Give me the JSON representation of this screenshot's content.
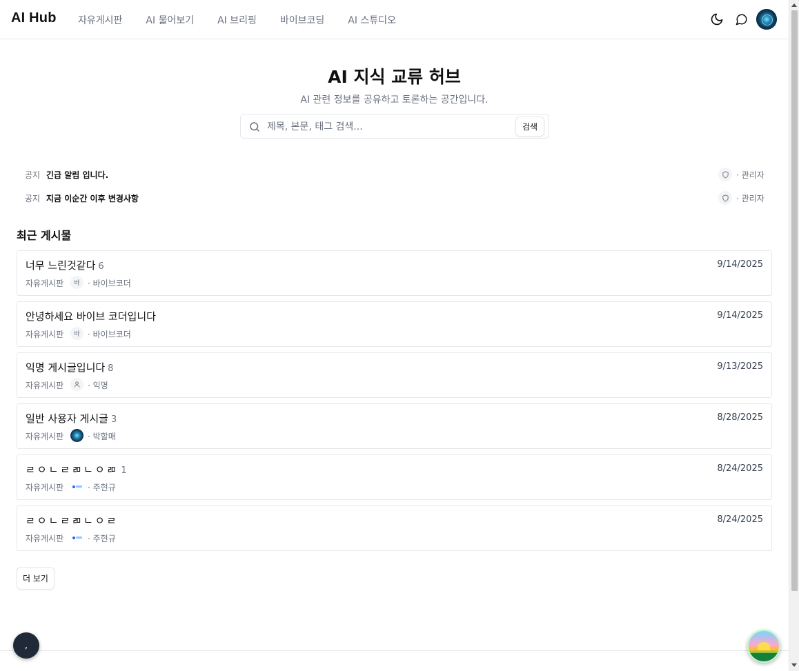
{
  "header": {
    "logo": "AI Hub",
    "nav": [
      {
        "label": "자유게시판"
      },
      {
        "label": "AI 물어보기"
      },
      {
        "label": "AI 브리핑"
      },
      {
        "label": "바이브코딩"
      },
      {
        "label": "AI 스튜디오"
      }
    ],
    "icons": [
      "moon-icon",
      "chat-bubble-icon",
      "user-avatar"
    ]
  },
  "hero": {
    "title": "AI 지식 교류 허브",
    "subtitle": "AI 관련 정보를 공유하고 토론하는 공간입니다.",
    "search_placeholder": "제목, 본문, 태그 검색...",
    "search_button": "검색"
  },
  "notices": [
    {
      "tag": "공지",
      "title": "긴급 알림 입니다.",
      "author": "· 관리자"
    },
    {
      "tag": "공지",
      "title": "지금 이순간 이후 변경사항",
      "author": "· 관리자"
    }
  ],
  "recent": {
    "title": "최근 게시물",
    "posts": [
      {
        "title": "너무 느린것같다",
        "count": "6",
        "date": "9/14/2025",
        "board": "자유게시판",
        "avatar_text": "바",
        "avatar_type": "text",
        "author": "· 바이브코더"
      },
      {
        "title": "안녕하세요 바이브 코더입니다",
        "count": "",
        "date": "9/14/2025",
        "board": "자유게시판",
        "avatar_text": "바",
        "avatar_type": "text",
        "author": "· 바이브코더"
      },
      {
        "title": "익명 게시글입니다",
        "count": "8",
        "date": "9/13/2025",
        "board": "자유게시판",
        "avatar_text": "",
        "avatar_type": "person",
        "author": "· 익명"
      },
      {
        "title": "일반 사용자 게시글",
        "count": "3",
        "date": "8/28/2025",
        "board": "자유게시판",
        "avatar_text": "",
        "avatar_type": "globe",
        "author": "· 박할매"
      },
      {
        "title": "ㄹㅇㄴㄹㄻㄴㅇㄻ",
        "count": "1",
        "date": "8/24/2025",
        "board": "자유게시판",
        "avatar_text": "",
        "avatar_type": "logo",
        "author": "· 주현규"
      },
      {
        "title": "ㄹㅇㄴㄹㄻㄴㅇㄹ",
        "count": "",
        "date": "8/24/2025",
        "board": "자유게시판",
        "avatar_text": "",
        "avatar_type": "logo",
        "author": "· 주현규"
      }
    ],
    "more_button": "더 보기"
  },
  "fab_left_label": ","
}
